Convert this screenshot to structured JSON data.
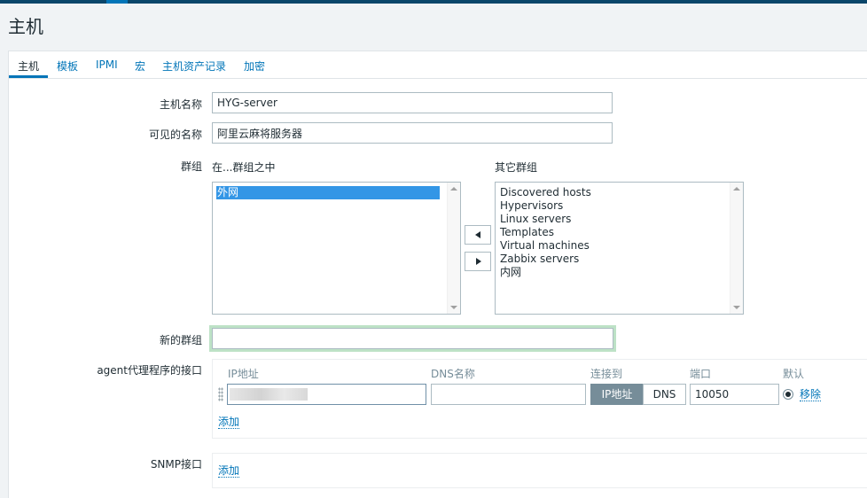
{
  "page": {
    "title": "主机"
  },
  "tabs": [
    {
      "label": "主机",
      "active": true
    },
    {
      "label": "模板"
    },
    {
      "label": "IPMI"
    },
    {
      "label": "宏"
    },
    {
      "label": "主机资产记录"
    },
    {
      "label": "加密"
    }
  ],
  "form": {
    "host_name_label": "主机名称",
    "host_name_value": "HYG-server",
    "visible_name_label": "可见的名称",
    "visible_name_value": "阿里云麻将服务器",
    "groups_label": "群组",
    "in_groups_label": "在...群组之中",
    "other_groups_label": "其它群组",
    "in_groups": [
      "外网"
    ],
    "other_groups": [
      "Discovered hosts",
      "Hypervisors",
      "Linux servers",
      "Templates",
      "Virtual machines",
      "Zabbix servers",
      "内网"
    ],
    "new_group_label": "新的群组",
    "new_group_value": ""
  },
  "agent_interfaces": {
    "label": "agent代理程序的接口",
    "col_ip": "IP地址",
    "col_dns": "DNS名称",
    "col_connect": "连接到",
    "col_port": "端口",
    "col_default": "默认",
    "dns_value": "",
    "connect_ip": "IP地址",
    "connect_dns": "DNS",
    "port_value": "10050",
    "remove_label": "移除",
    "add_label": "添加"
  },
  "snmp_interfaces": {
    "label": "SNMP接口",
    "add_label": "添加"
  },
  "colors": {
    "accent": "#0275b8",
    "selected": "#3396e6",
    "connect_active": "#768d99",
    "new_group_focus": "#bde2c6"
  },
  "icons": [
    "arrow-left-icon",
    "arrow-right-icon",
    "drag-handle-icon",
    "radio-selected-icon"
  ]
}
